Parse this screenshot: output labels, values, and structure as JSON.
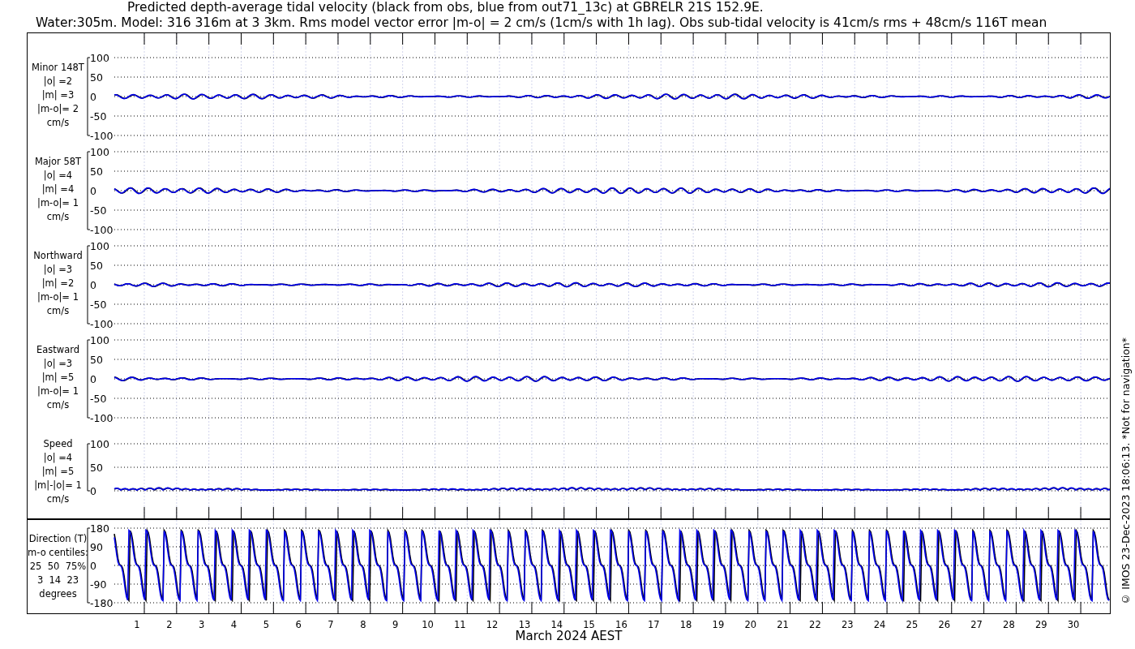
{
  "title_lines": [
    "Predicted depth-average tidal velocity (black from obs, blue from out71_13c) at GBRELR 21S 152.9E.",
    "Water:305m. Model: 316 316m at 3 3km. Rms model vector error |m-o| = 2 cm/s (1cm/s with 1h lag). Obs sub-tidal velocity is 41cm/s rms + 48cm/s 116T mean"
  ],
  "panels": [
    {
      "kind": "signed",
      "label_lines": [
        "Minor 148T",
        "|o| =2",
        "|m| =3",
        "|m-o|= 2",
        "cm/s"
      ],
      "yticks": [
        "100",
        "50",
        "0",
        "-50",
        "-100"
      ]
    },
    {
      "kind": "signed",
      "label_lines": [
        "Major 58T",
        "|o| =4",
        "|m| =4",
        "|m-o|= 1",
        "cm/s"
      ],
      "yticks": [
        "100",
        "50",
        "0",
        "-50",
        "-100"
      ]
    },
    {
      "kind": "signed",
      "label_lines": [
        "Northward",
        "|o| =3",
        "|m| =2",
        "|m-o|= 1",
        "cm/s"
      ],
      "yticks": [
        "100",
        "50",
        "0",
        "-50",
        "-100"
      ]
    },
    {
      "kind": "signed",
      "label_lines": [
        "Eastward",
        "|o| =3",
        "|m| =5",
        "|m-o|= 1",
        "cm/s"
      ],
      "yticks": [
        "100",
        "50",
        "0",
        "-50",
        "-100"
      ]
    },
    {
      "kind": "speed",
      "label_lines": [
        "Speed",
        "|o| =4",
        "|m| =5",
        "|m|-|o|= 1",
        "cm/s"
      ],
      "yticks": [
        "100",
        "50",
        "0"
      ]
    }
  ],
  "direction_panel": {
    "label_lines": [
      "Direction (T)",
      "m-o centiles:",
      "25  50  75%",
      "3  14  23",
      "degrees"
    ],
    "yticks": [
      "180",
      "90",
      "0",
      "-90",
      "-180"
    ]
  },
  "x_ticks": [
    "1",
    "2",
    "3",
    "4",
    "5",
    "6",
    "7",
    "8",
    "9",
    "10",
    "11",
    "12",
    "13",
    "14",
    "15",
    "16",
    "17",
    "18",
    "19",
    "20",
    "21",
    "22",
    "23",
    "24",
    "25",
    "26",
    "27",
    "28",
    "29",
    "30"
  ],
  "xlabel": "March 2024 AEST",
  "credit": "© IMOS 23-Dec-2023 18:06:13. *Not for navigation*"
}
